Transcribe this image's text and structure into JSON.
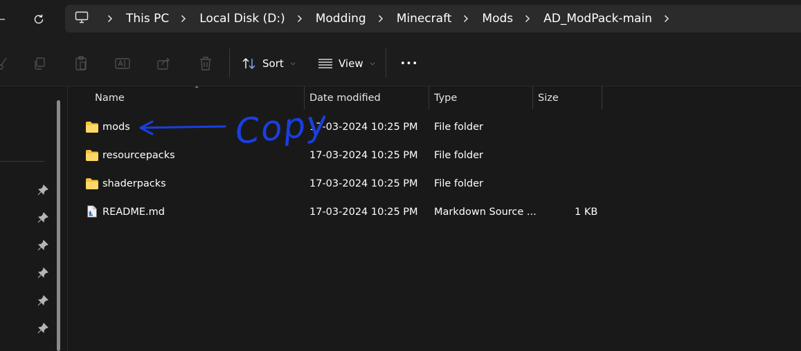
{
  "address_bar": {
    "breadcrumbs": [
      "This PC",
      "Local Disk (D:)",
      "Modding",
      "Minecraft",
      "Mods",
      "AD_ModPack-main"
    ]
  },
  "toolbar": {
    "sort_label": "Sort",
    "view_label": "View",
    "more_label": "•••"
  },
  "columns": {
    "name": "Name",
    "date": "Date modified",
    "type": "Type",
    "size": "Size"
  },
  "files": [
    {
      "name": "mods",
      "date": "17-03-2024 10:25 PM",
      "type": "File folder",
      "size": "",
      "icon": "folder-icon"
    },
    {
      "name": "resourcepacks",
      "date": "17-03-2024 10:25 PM",
      "type": "File folder",
      "size": "",
      "icon": "folder-icon"
    },
    {
      "name": "shaderpacks",
      "date": "17-03-2024 10:25 PM",
      "type": "File folder",
      "size": "",
      "icon": "folder-icon"
    },
    {
      "name": "README.md",
      "date": "17-03-2024 10:25 PM",
      "type": "Markdown Source ...",
      "size": "1 KB",
      "icon": "markdown-file-icon"
    }
  ],
  "annotation": {
    "text": "Copy",
    "color": "#1a3fe0"
  },
  "colors": {
    "background": "#191919",
    "address_bg": "#2b2b2b",
    "folder_yellow": "#f4c23f"
  }
}
